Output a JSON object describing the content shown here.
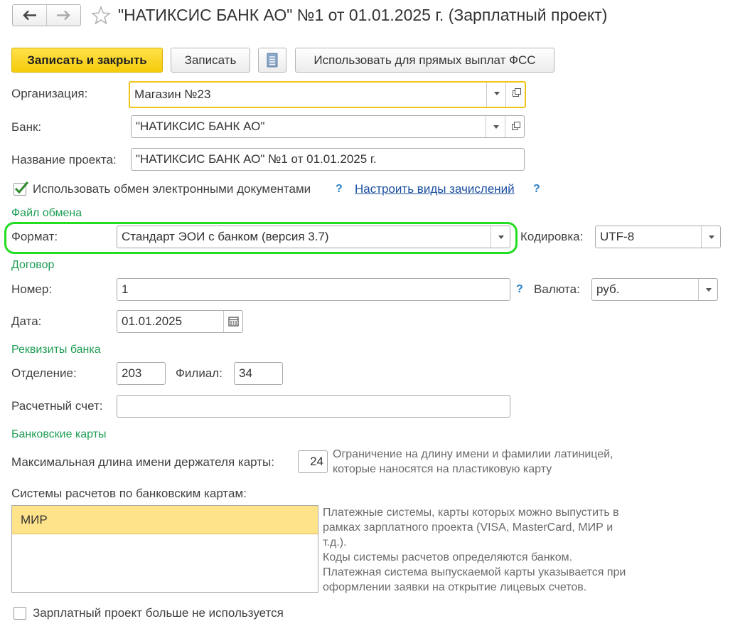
{
  "header": {
    "title": "\"НАТИКСИС БАНК АО\" №1 от 01.01.2025 г. (Зарплатный проект)"
  },
  "toolbar": {
    "save_close_label": "Записать и закрыть",
    "save_label": "Записать",
    "fss_label": "Использовать для прямых выплат ФСС"
  },
  "form": {
    "organization_label": "Организация:",
    "organization_value": "Магазин №23",
    "bank_label": "Банк:",
    "bank_value": "\"НАТИКСИС БАНК АО\"",
    "project_name_label": "Название проекта:",
    "project_name_value": "\"НАТИКСИС БАНК АО\" №1 от 01.01.2025 г.",
    "edo_checkbox_label": "Использовать обмен электронными документами",
    "edo_checked": true,
    "configure_link": "Настроить виды зачислений",
    "help_mark": "?"
  },
  "exchange": {
    "section_title": "Файл обмена",
    "format_label": "Формат:",
    "format_value": "Стандарт ЭОИ с банком (версия 3.7)",
    "encoding_label": "Кодировка:",
    "encoding_value": "UTF-8"
  },
  "contract": {
    "section_title": "Договор",
    "number_label": "Номер:",
    "number_value": "1",
    "currency_label": "Валюта:",
    "currency_value": "руб.",
    "date_label": "Дата:",
    "date_value": "01.01.2025"
  },
  "bank_details": {
    "section_title": "Реквизиты банка",
    "branch_label": "Отделение:",
    "branch_value": "203",
    "filial_label": "Филиал:",
    "filial_value": "34",
    "account_label": "Расчетный счет:",
    "account_value": ""
  },
  "cards": {
    "section_title": "Банковские карты",
    "max_len_label": "Максимальная длина имени держателя карты:",
    "max_len_value": "24",
    "max_len_hint_1": "Ограничение на длину имени и фамилии латиницей,",
    "max_len_hint_2": "которые наносятся на пластиковую карту",
    "systems_label": "Системы расчетов по банковским картам:",
    "systems": [
      "МИР"
    ],
    "systems_hint_1": "Платежные системы, карты которых можно выпустить в",
    "systems_hint_2": "рамках зарплатного проекта (VISA, MasterCard, МИР и",
    "systems_hint_3": "т.д.).",
    "systems_hint_4": "Коды системы расчетов определяются банком.",
    "systems_hint_5": "Платежная система выпускаемой карты указывается при",
    "systems_hint_6": "оформлении заявки на открытие лицевых счетов."
  },
  "footer": {
    "not_used_label": "Зарплатный проект больше не используется",
    "not_used_checked": false
  },
  "colors": {
    "primary_button": "#f5cb0a",
    "section_text": "#1f9d55",
    "focus_border": "#f0c419",
    "highlight_ring": "#22dd22",
    "selected_row": "#ffe38a"
  }
}
